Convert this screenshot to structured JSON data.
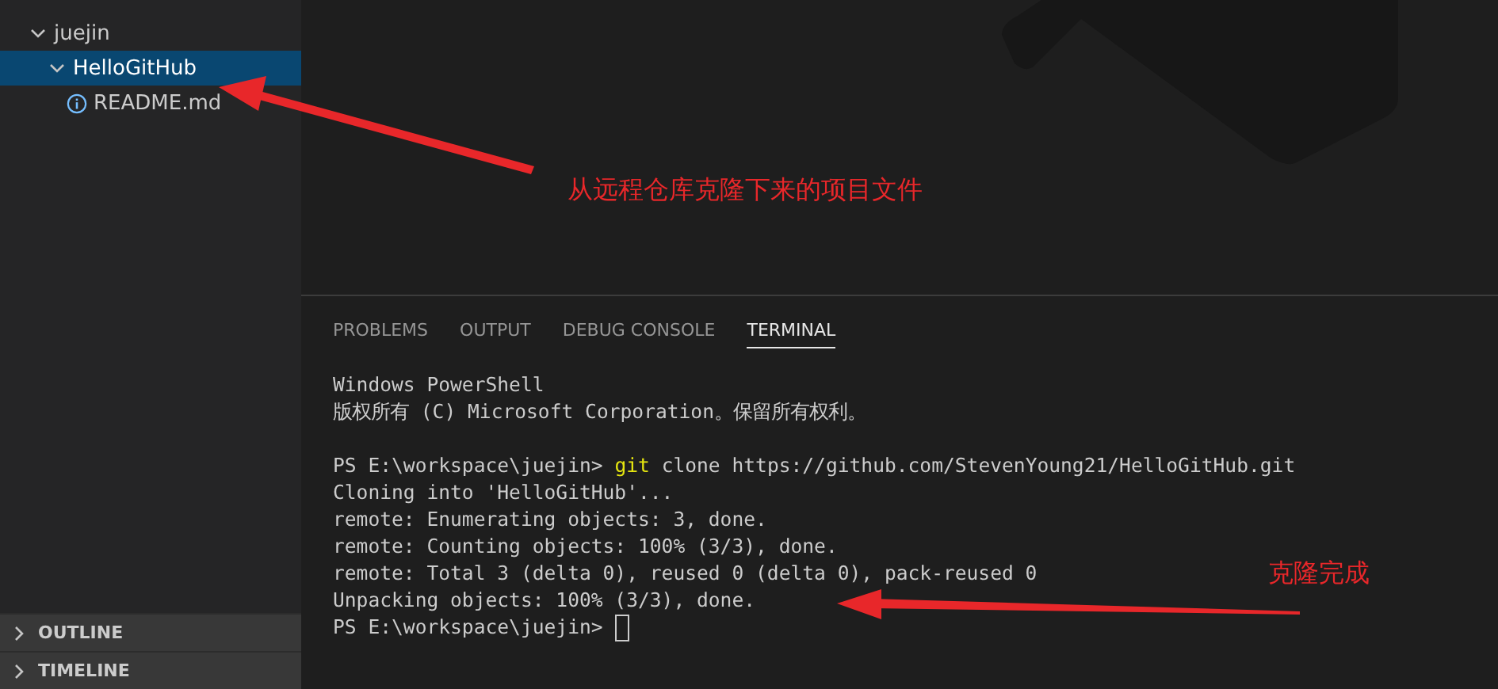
{
  "sidebar": {
    "tree": [
      {
        "label": "juejin",
        "kind": "folder",
        "expanded": true,
        "selected": false,
        "children": [
          {
            "label": "HelloGitHub",
            "kind": "folder",
            "expanded": true,
            "selected": true,
            "children": [
              {
                "label": "README.md",
                "kind": "info-file",
                "selected": false
              }
            ]
          }
        ]
      }
    ],
    "sections": [
      {
        "label": "OUTLINE",
        "expanded": false
      },
      {
        "label": "TIMELINE",
        "expanded": false
      }
    ]
  },
  "panel": {
    "tabs": [
      {
        "label": "PROBLEMS",
        "selected": false
      },
      {
        "label": "OUTPUT",
        "selected": false
      },
      {
        "label": "DEBUG CONSOLE",
        "selected": false
      },
      {
        "label": "TERMINAL",
        "selected": true
      }
    ],
    "terminal": [
      {
        "kind": "text",
        "text": "Windows PowerShell"
      },
      {
        "kind": "text",
        "text": "版权所有 (C) Microsoft Corporation。保留所有权利。"
      },
      {
        "kind": "blank"
      },
      {
        "kind": "command",
        "prompt": "PS E:\\workspace\\juejin>",
        "command": "git",
        "args": "clone https://github.com/StevenYoung21/HelloGitHub.git"
      },
      {
        "kind": "text",
        "text": "Cloning into 'HelloGitHub'..."
      },
      {
        "kind": "text",
        "text": "remote: Enumerating objects: 3, done."
      },
      {
        "kind": "text",
        "text": "remote: Counting objects: 100% (3/3), done."
      },
      {
        "kind": "text",
        "text": "remote: Total 3 (delta 0), reused 0 (delta 0), pack-reused 0"
      },
      {
        "kind": "text",
        "text": "Unpacking objects: 100% (3/3), done."
      },
      {
        "kind": "input",
        "prompt": "PS E:\\workspace\\juejin>"
      }
    ]
  },
  "annotations": [
    {
      "text": "从远程仓库克隆下来的项目文件"
    },
    {
      "text": "克隆完成"
    }
  ]
}
